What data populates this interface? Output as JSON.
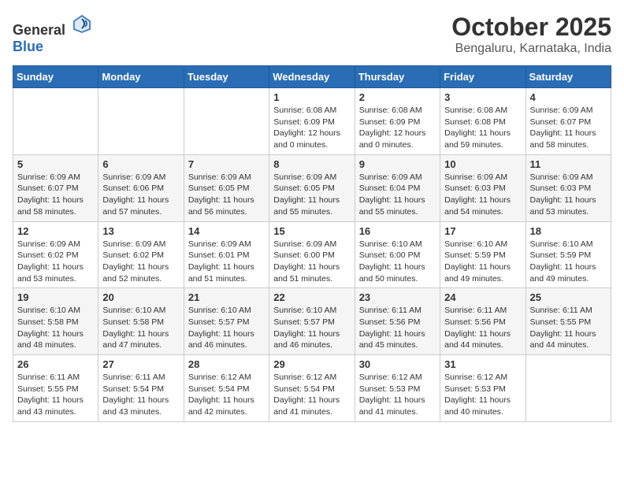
{
  "header": {
    "logo_general": "General",
    "logo_blue": "Blue",
    "month": "October 2025",
    "location": "Bengaluru, Karnataka, India"
  },
  "weekdays": [
    "Sunday",
    "Monday",
    "Tuesday",
    "Wednesday",
    "Thursday",
    "Friday",
    "Saturday"
  ],
  "weeks": [
    [
      {
        "day": "",
        "info": ""
      },
      {
        "day": "",
        "info": ""
      },
      {
        "day": "",
        "info": ""
      },
      {
        "day": "1",
        "info": "Sunrise: 6:08 AM\nSunset: 6:09 PM\nDaylight: 12 hours\nand 0 minutes."
      },
      {
        "day": "2",
        "info": "Sunrise: 6:08 AM\nSunset: 6:09 PM\nDaylight: 12 hours\nand 0 minutes."
      },
      {
        "day": "3",
        "info": "Sunrise: 6:08 AM\nSunset: 6:08 PM\nDaylight: 11 hours\nand 59 minutes."
      },
      {
        "day": "4",
        "info": "Sunrise: 6:09 AM\nSunset: 6:07 PM\nDaylight: 11 hours\nand 58 minutes."
      }
    ],
    [
      {
        "day": "5",
        "info": "Sunrise: 6:09 AM\nSunset: 6:07 PM\nDaylight: 11 hours\nand 58 minutes."
      },
      {
        "day": "6",
        "info": "Sunrise: 6:09 AM\nSunset: 6:06 PM\nDaylight: 11 hours\nand 57 minutes."
      },
      {
        "day": "7",
        "info": "Sunrise: 6:09 AM\nSunset: 6:05 PM\nDaylight: 11 hours\nand 56 minutes."
      },
      {
        "day": "8",
        "info": "Sunrise: 6:09 AM\nSunset: 6:05 PM\nDaylight: 11 hours\nand 55 minutes."
      },
      {
        "day": "9",
        "info": "Sunrise: 6:09 AM\nSunset: 6:04 PM\nDaylight: 11 hours\nand 55 minutes."
      },
      {
        "day": "10",
        "info": "Sunrise: 6:09 AM\nSunset: 6:03 PM\nDaylight: 11 hours\nand 54 minutes."
      },
      {
        "day": "11",
        "info": "Sunrise: 6:09 AM\nSunset: 6:03 PM\nDaylight: 11 hours\nand 53 minutes."
      }
    ],
    [
      {
        "day": "12",
        "info": "Sunrise: 6:09 AM\nSunset: 6:02 PM\nDaylight: 11 hours\nand 53 minutes."
      },
      {
        "day": "13",
        "info": "Sunrise: 6:09 AM\nSunset: 6:02 PM\nDaylight: 11 hours\nand 52 minutes."
      },
      {
        "day": "14",
        "info": "Sunrise: 6:09 AM\nSunset: 6:01 PM\nDaylight: 11 hours\nand 51 minutes."
      },
      {
        "day": "15",
        "info": "Sunrise: 6:09 AM\nSunset: 6:00 PM\nDaylight: 11 hours\nand 51 minutes."
      },
      {
        "day": "16",
        "info": "Sunrise: 6:10 AM\nSunset: 6:00 PM\nDaylight: 11 hours\nand 50 minutes."
      },
      {
        "day": "17",
        "info": "Sunrise: 6:10 AM\nSunset: 5:59 PM\nDaylight: 11 hours\nand 49 minutes."
      },
      {
        "day": "18",
        "info": "Sunrise: 6:10 AM\nSunset: 5:59 PM\nDaylight: 11 hours\nand 49 minutes."
      }
    ],
    [
      {
        "day": "19",
        "info": "Sunrise: 6:10 AM\nSunset: 5:58 PM\nDaylight: 11 hours\nand 48 minutes."
      },
      {
        "day": "20",
        "info": "Sunrise: 6:10 AM\nSunset: 5:58 PM\nDaylight: 11 hours\nand 47 minutes."
      },
      {
        "day": "21",
        "info": "Sunrise: 6:10 AM\nSunset: 5:57 PM\nDaylight: 11 hours\nand 46 minutes."
      },
      {
        "day": "22",
        "info": "Sunrise: 6:10 AM\nSunset: 5:57 PM\nDaylight: 11 hours\nand 46 minutes."
      },
      {
        "day": "23",
        "info": "Sunrise: 6:11 AM\nSunset: 5:56 PM\nDaylight: 11 hours\nand 45 minutes."
      },
      {
        "day": "24",
        "info": "Sunrise: 6:11 AM\nSunset: 5:56 PM\nDaylight: 11 hours\nand 44 minutes."
      },
      {
        "day": "25",
        "info": "Sunrise: 6:11 AM\nSunset: 5:55 PM\nDaylight: 11 hours\nand 44 minutes."
      }
    ],
    [
      {
        "day": "26",
        "info": "Sunrise: 6:11 AM\nSunset: 5:55 PM\nDaylight: 11 hours\nand 43 minutes."
      },
      {
        "day": "27",
        "info": "Sunrise: 6:11 AM\nSunset: 5:54 PM\nDaylight: 11 hours\nand 43 minutes."
      },
      {
        "day": "28",
        "info": "Sunrise: 6:12 AM\nSunset: 5:54 PM\nDaylight: 11 hours\nand 42 minutes."
      },
      {
        "day": "29",
        "info": "Sunrise: 6:12 AM\nSunset: 5:54 PM\nDaylight: 11 hours\nand 41 minutes."
      },
      {
        "day": "30",
        "info": "Sunrise: 6:12 AM\nSunset: 5:53 PM\nDaylight: 11 hours\nand 41 minutes."
      },
      {
        "day": "31",
        "info": "Sunrise: 6:12 AM\nSunset: 5:53 PM\nDaylight: 11 hours\nand 40 minutes."
      },
      {
        "day": "",
        "info": ""
      }
    ]
  ]
}
